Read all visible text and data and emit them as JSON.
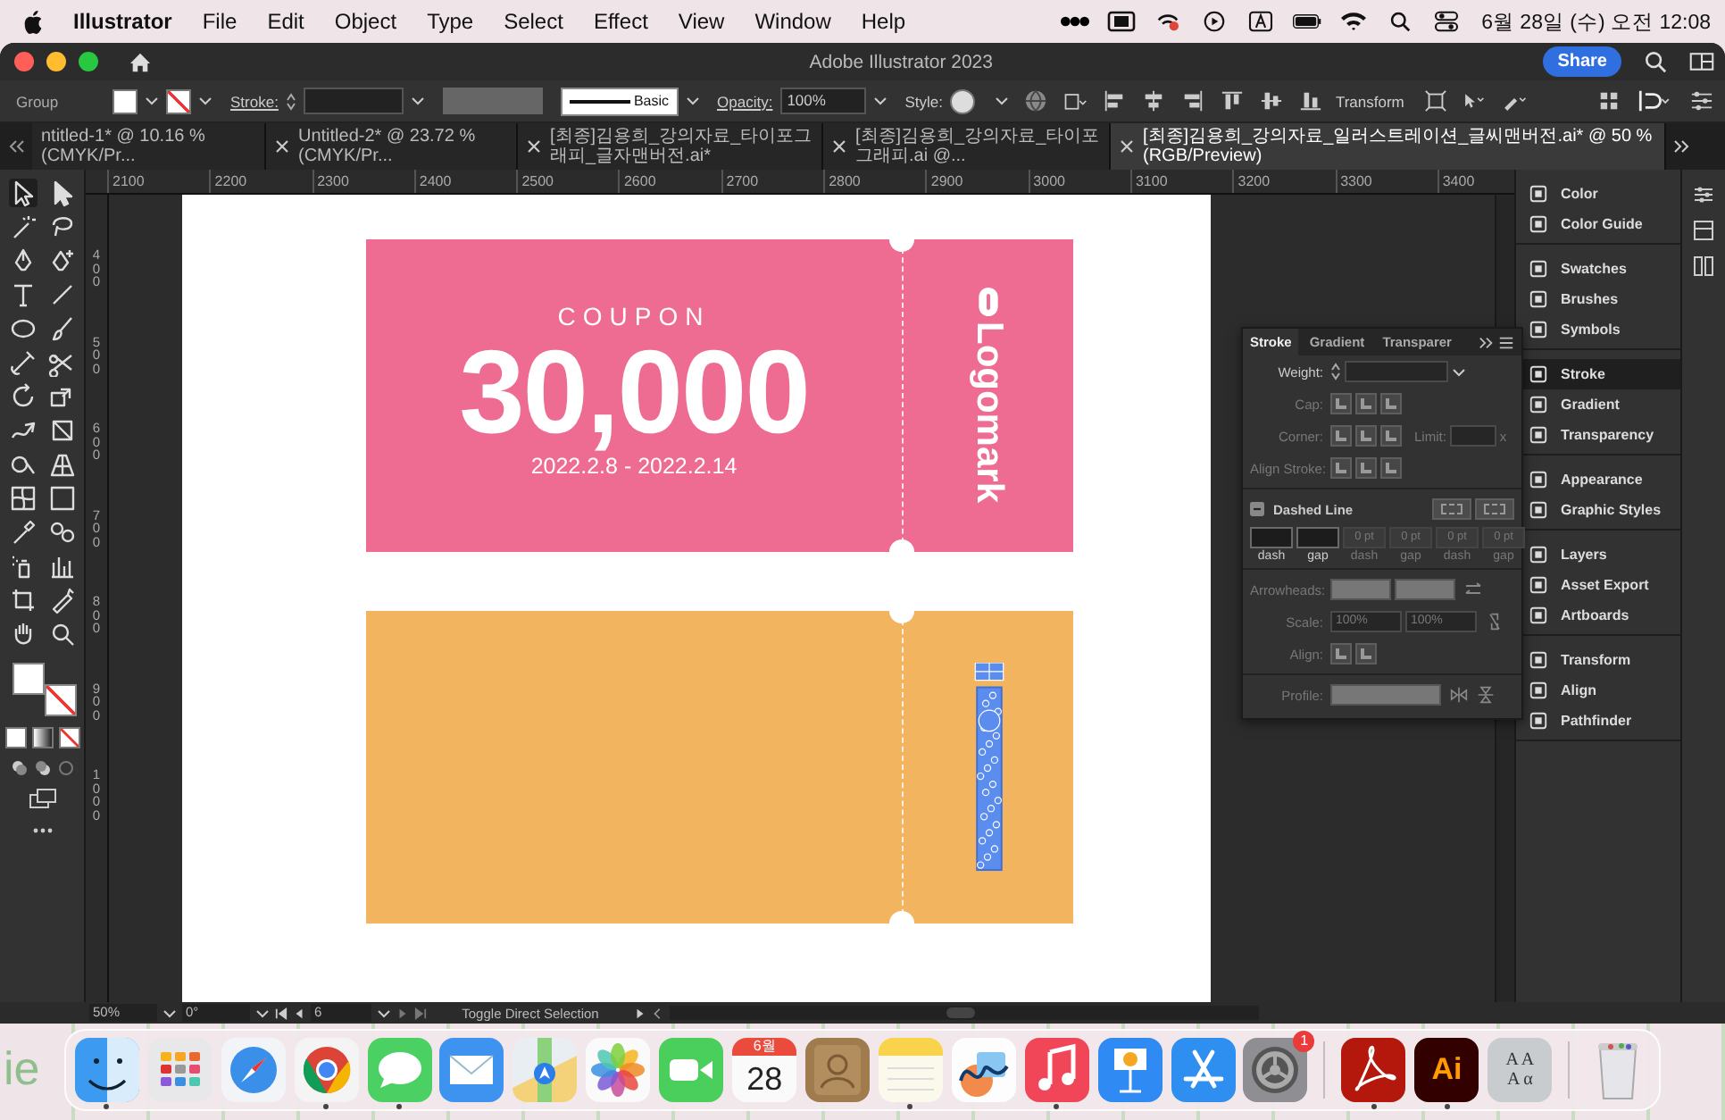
{
  "menubar": {
    "app": "Illustrator",
    "items": [
      "File",
      "Edit",
      "Object",
      "Type",
      "Select",
      "Effect",
      "View",
      "Window",
      "Help"
    ],
    "clock": "6월 28일 (수) 오전 12:08"
  },
  "window": {
    "title": "Adobe Illustrator 2023",
    "share": "Share"
  },
  "control_bar": {
    "selection": "Group",
    "stroke_label": "Stroke:",
    "profile": "Basic",
    "opacity_label": "Opacity:",
    "opacity": "100%",
    "style_label": "Style:",
    "transform": "Transform"
  },
  "tabs": [
    {
      "label": "ntitled-1* @ 10.16 % (CMYK/Pr...",
      "selected": false,
      "closable": false
    },
    {
      "label": "Untitled-2* @ 23.72 % (CMYK/Pr...",
      "selected": false,
      "closable": true
    },
    {
      "label": "[최종]김용희_강의자료_타이포그래피_글자맨버전.ai*",
      "selected": false,
      "closable": true
    },
    {
      "label": "[최종]김용희_강의자료_타이포그래피.ai @...",
      "selected": false,
      "closable": true
    },
    {
      "label": "[최종]김용희_강의자료_일러스트레이션_글씨맨버전.ai* @ 50 % (RGB/Preview)",
      "selected": true,
      "closable": true
    }
  ],
  "ruler": {
    "horizontal": [
      "2100",
      "2200",
      "2300",
      "2400",
      "2500",
      "2600",
      "2700",
      "2800",
      "2900",
      "3000",
      "3100",
      "3200",
      "3300",
      "3400"
    ],
    "vertical": [
      "400",
      "500",
      "600",
      "700",
      "800",
      "900",
      "1000"
    ]
  },
  "coupons": [
    {
      "kind": "logo",
      "title": "COUPON",
      "amount": "30,000",
      "dates": "2022.2.8 - 2022.2.14",
      "logo": "Logomark",
      "color": "#ee6b91"
    },
    {
      "kind": "selected_outline",
      "color": "#f2b45f"
    }
  ],
  "stroke_panel": {
    "tabs": [
      {
        "label": "Stroke",
        "selected": true
      },
      {
        "label": "Gradient",
        "selected": false
      },
      {
        "label": "Transparer",
        "selected": false
      }
    ],
    "weight": {
      "label": "Weight:",
      "disabled": false
    },
    "cap": {
      "label": "Cap:",
      "disabled": true
    },
    "corner": {
      "label": "Corner:",
      "limit_label": "Limit:",
      "suffix": "x",
      "disabled": true
    },
    "align_stroke": {
      "label": "Align Stroke:",
      "disabled": true
    },
    "dashed_line": {
      "label": "Dashed Line"
    },
    "dash_fields": [
      {
        "caption": "dash",
        "disabled": false
      },
      {
        "caption": "gap",
        "disabled": false
      },
      {
        "value": "0 pt",
        "caption": "dash",
        "disabled": true
      },
      {
        "value": "0 pt",
        "caption": "gap",
        "disabled": true
      },
      {
        "value": "0 pt",
        "caption": "dash",
        "disabled": true
      },
      {
        "value": "0 pt",
        "caption": "gap",
        "disabled": true
      }
    ],
    "arrowheads": {
      "label": "Arrowheads:",
      "disabled": true
    },
    "scale": {
      "label": "Scale:",
      "values": [
        "100%",
        "100%"
      ],
      "disabled": true
    },
    "align": {
      "label": "Align:",
      "disabled": true
    },
    "profile": {
      "label": "Profile:",
      "disabled": true
    }
  },
  "panel_groups": [
    {
      "items": [
        {
          "label": "Color",
          "selected": false
        },
        {
          "label": "Color Guide",
          "selected": false
        }
      ]
    },
    {
      "items": [
        {
          "label": "Swatches",
          "selected": false
        },
        {
          "label": "Brushes",
          "selected": false
        },
        {
          "label": "Symbols",
          "selected": false
        }
      ]
    },
    {
      "items": [
        {
          "label": "Stroke",
          "selected": true
        },
        {
          "label": "Gradient",
          "selected": false
        },
        {
          "label": "Transparency",
          "selected": false
        }
      ]
    },
    {
      "items": [
        {
          "label": "Appearance",
          "selected": false
        },
        {
          "label": "Graphic Styles",
          "selected": false
        }
      ]
    },
    {
      "items": [
        {
          "label": "Layers",
          "selected": false
        },
        {
          "label": "Asset Export",
          "selected": false
        },
        {
          "label": "Artboards",
          "selected": false
        }
      ]
    },
    {
      "items": [
        {
          "label": "Transform",
          "selected": false
        },
        {
          "label": "Align",
          "selected": false
        },
        {
          "label": "Pathfinder",
          "selected": false
        }
      ]
    }
  ],
  "status_bar": {
    "zoom": "50%",
    "rotation": "0°",
    "artboard": "6",
    "tool_hint": "Toggle Direct Selection"
  },
  "desktop": {
    "text": "ie"
  },
  "dock": [
    {
      "kind": "finder",
      "running": true
    },
    {
      "kind": "launchpad",
      "running": false
    },
    {
      "kind": "safari",
      "running": false
    },
    {
      "kind": "chrome",
      "running": true
    },
    {
      "kind": "messages",
      "running": true
    },
    {
      "kind": "mail",
      "running": false
    },
    {
      "kind": "maps",
      "running": false
    },
    {
      "kind": "photos",
      "running": false
    },
    {
      "kind": "facetime",
      "running": false
    },
    {
      "kind": "calendar",
      "running": false,
      "month": "6월",
      "day": "28"
    },
    {
      "kind": "contacts",
      "running": false
    },
    {
      "kind": "notes",
      "running": true
    },
    {
      "kind": "freeform",
      "running": false
    },
    {
      "kind": "music",
      "running": true
    },
    {
      "kind": "keynote",
      "running": false
    },
    {
      "kind": "appstore",
      "running": false
    },
    {
      "kind": "settings",
      "running": false,
      "badge": "1"
    },
    {
      "kind": "separator"
    },
    {
      "kind": "acrobat",
      "running": true
    },
    {
      "kind": "illustrator",
      "running": true,
      "label": "Ai"
    },
    {
      "kind": "fontbook",
      "running": false,
      "lines": [
        "A A",
        "A α"
      ]
    },
    {
      "kind": "separator"
    },
    {
      "kind": "trash",
      "running": false
    }
  ]
}
